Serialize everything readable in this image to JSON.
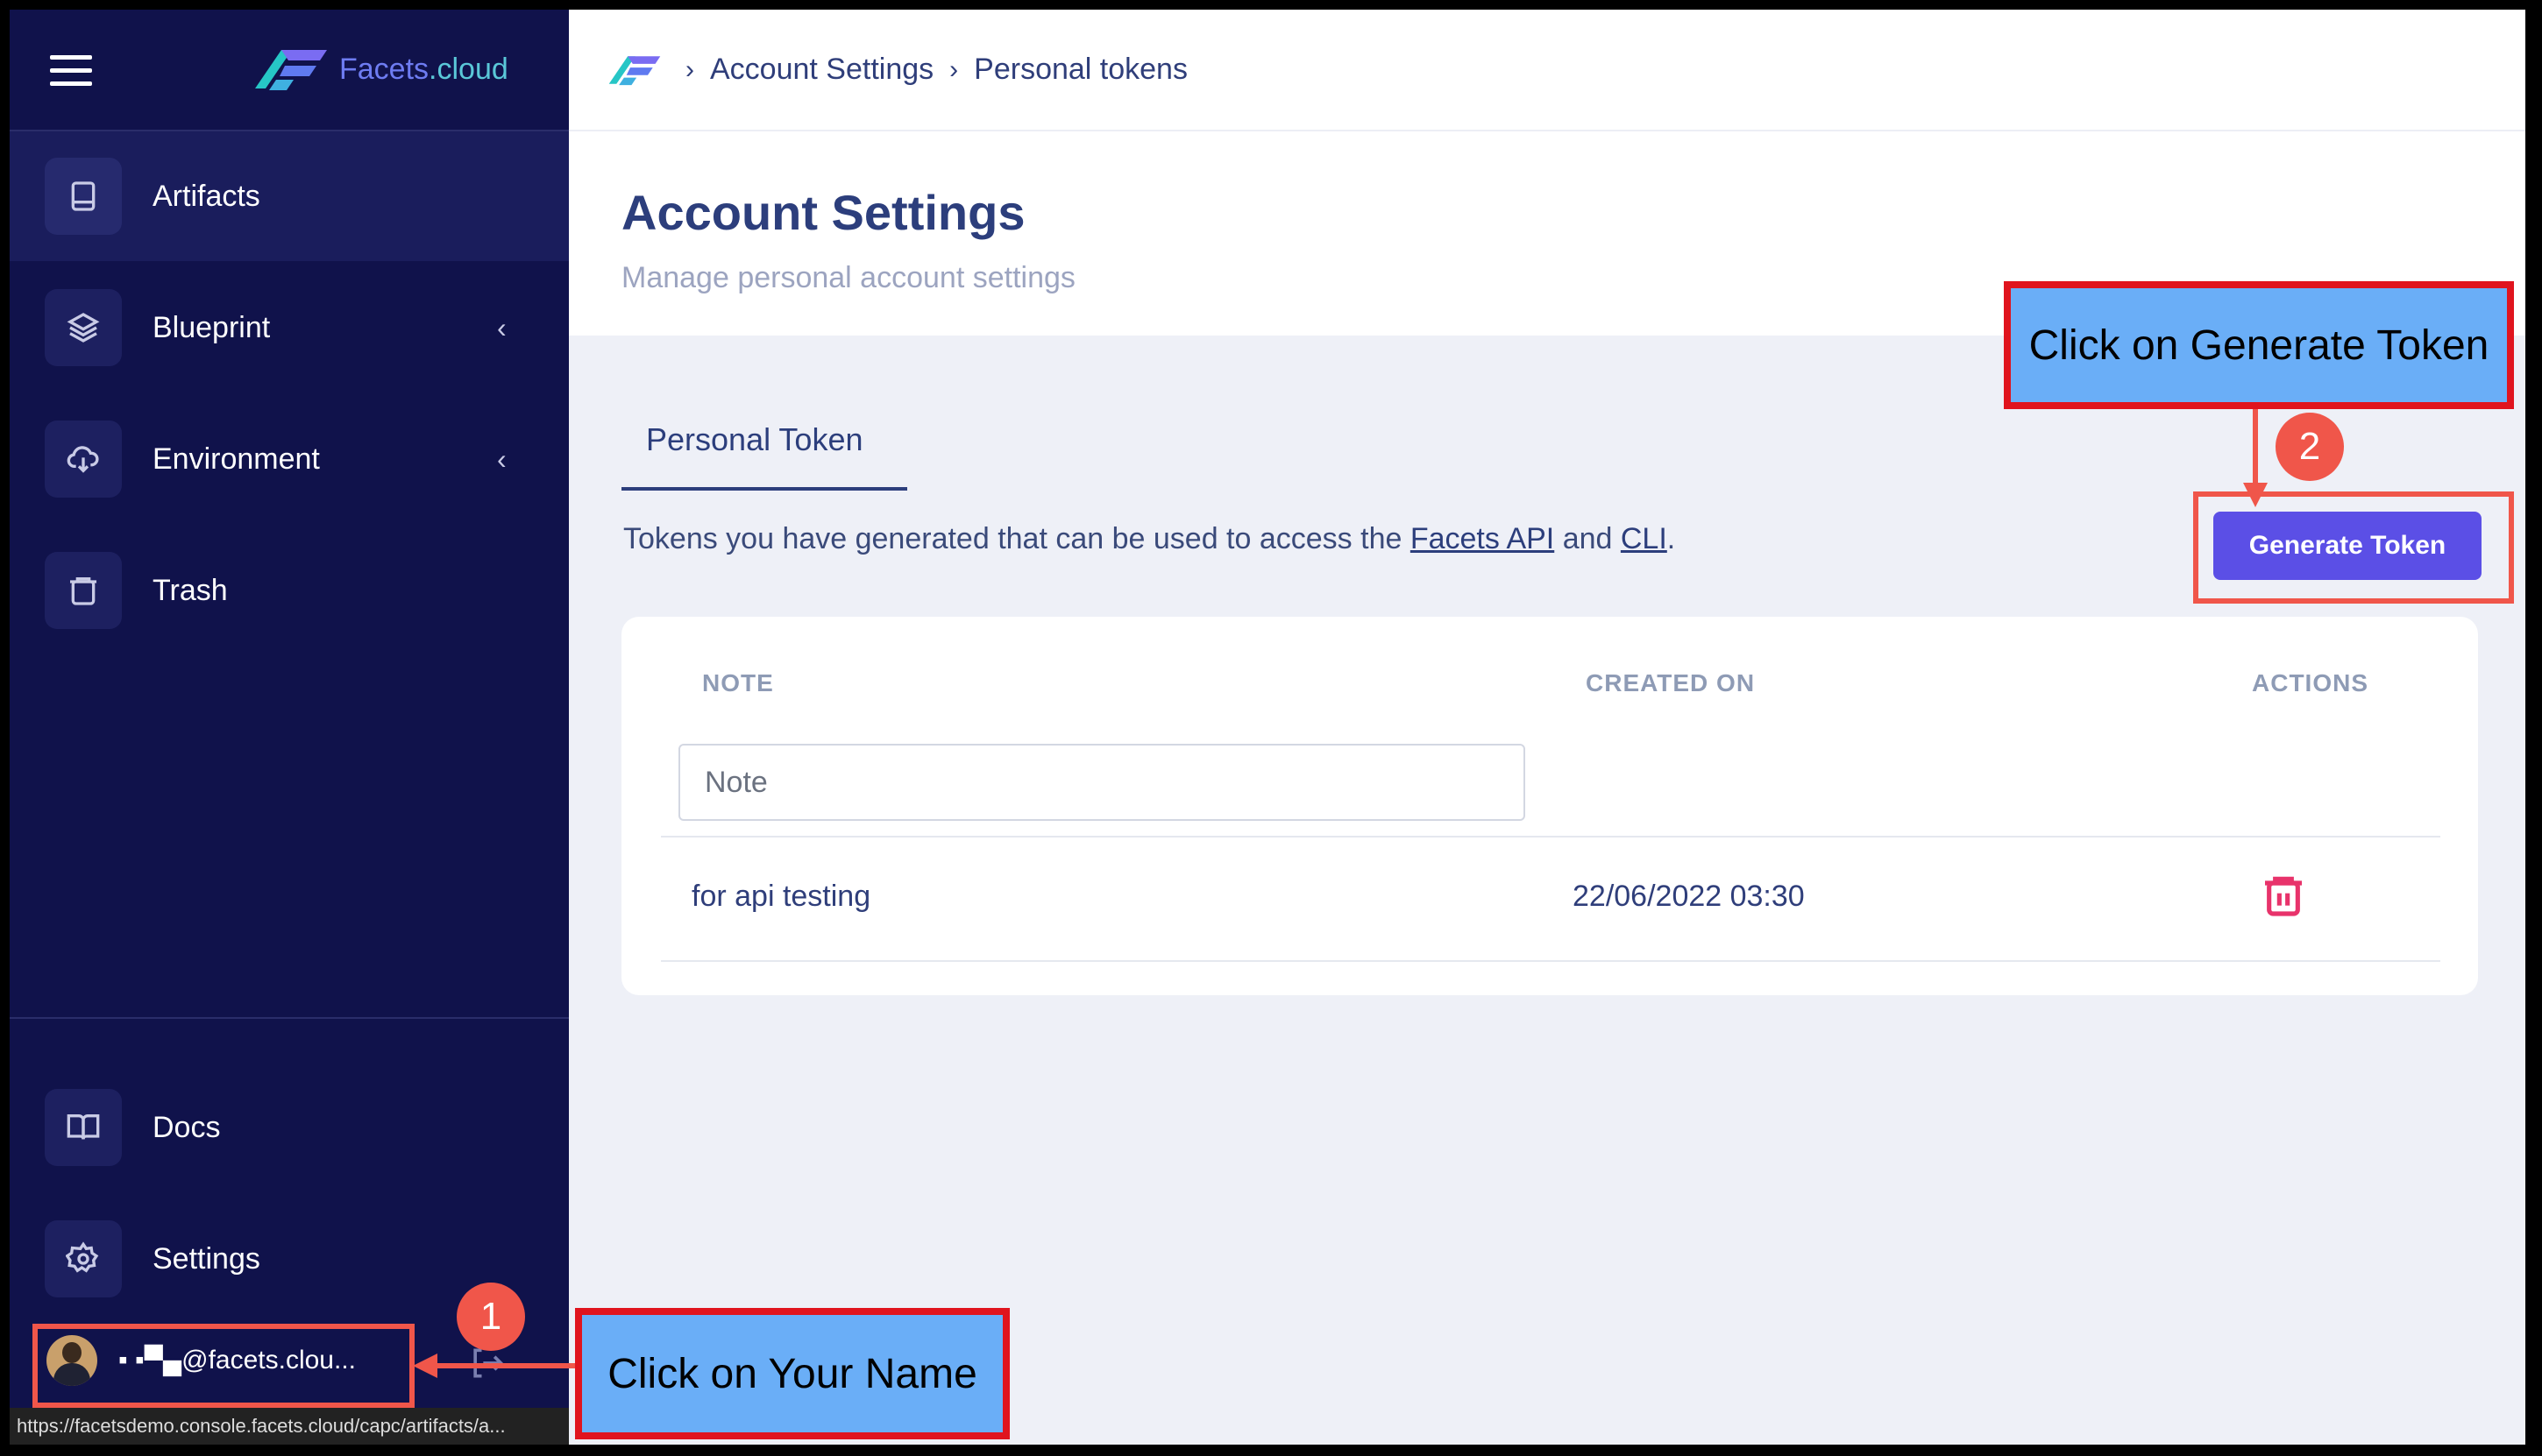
{
  "app": {
    "brand_name": "Facets",
    "brand_suffix": ".cloud"
  },
  "sidebar": {
    "items": [
      {
        "label": "Artifacts",
        "icon": "book-icon",
        "active": true
      },
      {
        "label": "Blueprint",
        "icon": "layers-icon",
        "chevron": "‹"
      },
      {
        "label": "Environment",
        "icon": "cloud-download-icon",
        "chevron": "‹"
      },
      {
        "label": "Trash",
        "icon": "trash-icon"
      }
    ],
    "bottom_items": [
      {
        "label": "Docs",
        "icon": "open-book-icon"
      },
      {
        "label": "Settings",
        "icon": "gear-icon"
      }
    ],
    "user": {
      "name": "▪ ▪▀▄@facets.clou..."
    },
    "status_url": "https://facetsdemo.console.facets.cloud/capc/artifacts/a..."
  },
  "breadcrumb": {
    "separator": "›",
    "items": [
      "Account Settings",
      "Personal tokens"
    ]
  },
  "page": {
    "title": "Account Settings",
    "subtitle": "Manage personal account settings"
  },
  "tabs": [
    {
      "label": "Personal Token",
      "active": true
    }
  ],
  "description": {
    "prefix": "Tokens you have generated that can be used to access the ",
    "link1": "Facets API",
    "middle": " and ",
    "link2": "CLI",
    "suffix": "."
  },
  "generate_button": {
    "label": "Generate Token"
  },
  "table": {
    "columns": [
      "NOTE",
      "CREATED ON",
      "ACTIONS"
    ],
    "note_placeholder": "Note",
    "rows": [
      {
        "note": "for api testing",
        "created_on": "22/06/2022 03:30"
      }
    ]
  },
  "annotations": {
    "step1": {
      "number": "1",
      "text": "Click on Your Name"
    },
    "step2": {
      "number": "2",
      "text": "Click on Generate Token"
    }
  },
  "colors": {
    "sidebar_bg": "#10124b",
    "accent": "#5b4fe6",
    "annotation_red": "#e0141e",
    "callout_blue": "#6aaef7"
  }
}
